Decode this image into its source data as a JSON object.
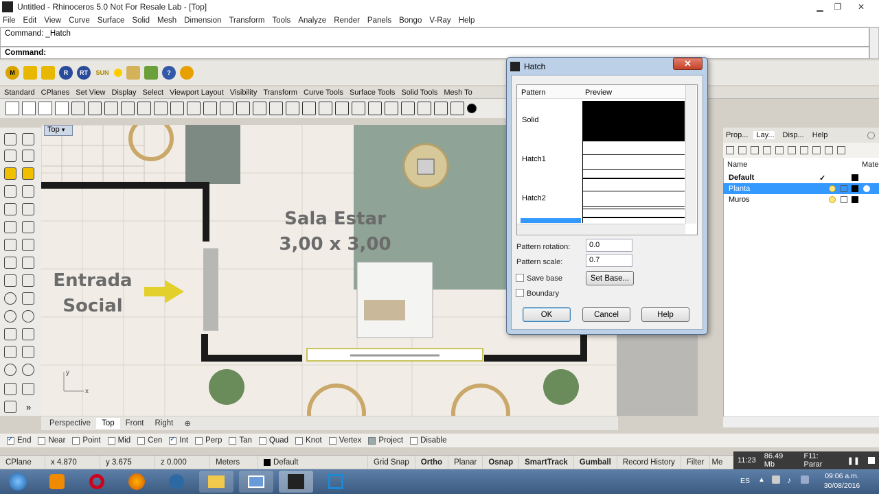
{
  "window": {
    "title": "Untitled - Rhinoceros 5.0 Not For Resale Lab - [Top]"
  },
  "menu": [
    "File",
    "Edit",
    "View",
    "Curve",
    "Surface",
    "Solid",
    "Mesh",
    "Dimension",
    "Transform",
    "Tools",
    "Analyze",
    "Render",
    "Panels",
    "Bongo",
    "V-Ray",
    "Help"
  ],
  "command": {
    "history": "Command: _Hatch",
    "prompt": "Command:"
  },
  "toolbar_icons": [
    "M",
    "",
    "",
    "R",
    "RT",
    "SUN"
  ],
  "toolbar_tabs": [
    "Standard",
    "CPlanes",
    "Set View",
    "Display",
    "Select",
    "Viewport Layout",
    "Visibility",
    "Transform",
    "Curve Tools",
    "Surface Tools",
    "Solid Tools",
    "Mesh To"
  ],
  "viewport": {
    "label": "Top",
    "room1_title": "Sala Estar",
    "room1_size": "3,00 x 3,00",
    "room2_line1": "Entrada",
    "room2_line2": "Social",
    "axis_y": "y",
    "axis_x": "x"
  },
  "viewport_tabs": [
    "Perspective",
    "Top",
    "Front",
    "Right"
  ],
  "osnaps": [
    {
      "label": "End",
      "checked": true
    },
    {
      "label": "Near",
      "checked": false
    },
    {
      "label": "Point",
      "checked": false
    },
    {
      "label": "Mid",
      "checked": false
    },
    {
      "label": "Cen",
      "checked": false
    },
    {
      "label": "Int",
      "checked": true
    },
    {
      "label": "Perp",
      "checked": false
    },
    {
      "label": "Tan",
      "checked": false
    },
    {
      "label": "Quad",
      "checked": false
    },
    {
      "label": "Knot",
      "checked": false
    },
    {
      "label": "Vertex",
      "checked": false
    },
    {
      "label": "Project",
      "checked": false
    },
    {
      "label": "Disable",
      "checked": false
    }
  ],
  "status": {
    "cplane": "CPlane",
    "x": "x 4.870",
    "y": "y 3.675",
    "z": "z 0.000",
    "units": "Meters",
    "layer": "Default",
    "grid_snap": "Grid Snap",
    "ortho": "Ortho",
    "planar": "Planar",
    "osnap": "Osnap",
    "smarttrack": "SmartTrack",
    "gumball": "Gumball",
    "record_history": "Record History",
    "filter": "Filter",
    "me": "Me"
  },
  "tray": {
    "time": "11:23",
    "memory": "86.49 Mb",
    "hint": "F11: Parar",
    "lang": "ES",
    "clock_time": "09:06 a.m.",
    "clock_date": "30/08/2016"
  },
  "right_panel": {
    "tabs": [
      "Prop...",
      "Lay...",
      "Disp...",
      "Help"
    ],
    "col_name": "Name",
    "col_mat": "Mate",
    "layers": [
      {
        "name": "Default",
        "current": true,
        "selected": false
      },
      {
        "name": "Planta",
        "current": false,
        "selected": true
      },
      {
        "name": "Muros",
        "current": false,
        "selected": false
      }
    ],
    "check": "✓"
  },
  "hatch_dialog": {
    "title": "Hatch",
    "col_pattern": "Pattern",
    "col_preview": "Preview",
    "patterns": [
      "Solid",
      "Hatch1",
      "Hatch2"
    ],
    "rotation_label": "Pattern rotation:",
    "rotation_value": "0.0",
    "scale_label": "Pattern scale:",
    "scale_value": "0.7",
    "save_base_label": "Save base",
    "set_base_label": "Set Base...",
    "boundary_label": "Boundary",
    "ok": "OK",
    "cancel": "Cancel",
    "help": "Help"
  },
  "colors": {
    "accent": "#3399ff",
    "wall": "#1a1a1a",
    "rug": "#8aa08a",
    "arrow": "#e3d02a"
  }
}
